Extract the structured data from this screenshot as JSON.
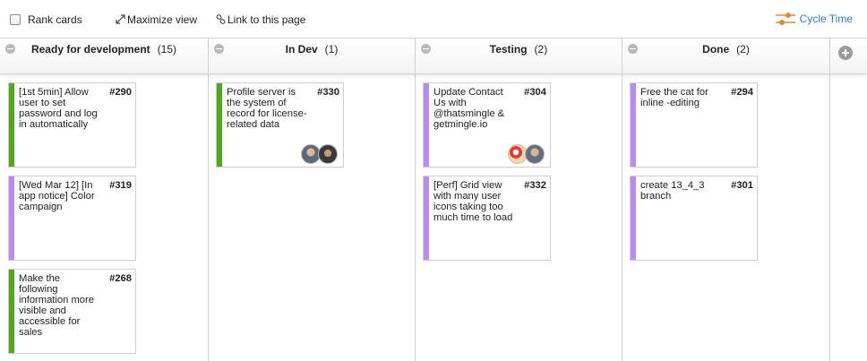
{
  "toolbar": {
    "rank_cards": "Rank cards",
    "maximize_view": "Maximize view",
    "link_to_page": "Link to this page",
    "cycle_time": "Cycle Time"
  },
  "colors": {
    "green": "#52a81c",
    "purple": "#b98cf2",
    "link": "#2a7fc2",
    "cycle_icon": "#e8852a"
  },
  "columns": [
    {
      "name": "Ready for development",
      "count": "(15)",
      "cards": [
        {
          "title": "[1st 5min] Allow user to set password and log in automatically",
          "number": "#290",
          "color": "green"
        },
        {
          "title": "[Wed Mar 12] [In app notice] Color campaign",
          "number": "#319",
          "color": "purple"
        },
        {
          "title": "Make the following information more visible and accessible for sales",
          "number": "#268",
          "color": "green"
        }
      ]
    },
    {
      "name": "In Dev",
      "count": "(1)",
      "cards": [
        {
          "title": "Profile server is the system of record for license-related data",
          "number": "#330",
          "color": "green",
          "avatars": [
            "user-avatar",
            "user-avatar"
          ]
        }
      ]
    },
    {
      "name": "Testing",
      "count": "(2)",
      "cards": [
        {
          "title": "Update Contact Us with @thatsmingle & getmingle.io",
          "number": "#304",
          "color": "purple",
          "avatars": [
            "cartoon-avatar",
            "user-avatar"
          ]
        },
        {
          "title": "[Perf] Grid view with many user icons taking too much time to load",
          "number": "#332",
          "color": "purple"
        }
      ]
    },
    {
      "name": "Done",
      "count": "(2)",
      "cards": [
        {
          "title": "Free the cat for inline -editing",
          "number": "#294",
          "color": "purple"
        },
        {
          "title": "create 13_4_3 branch",
          "number": "#301",
          "color": "purple"
        }
      ]
    }
  ]
}
